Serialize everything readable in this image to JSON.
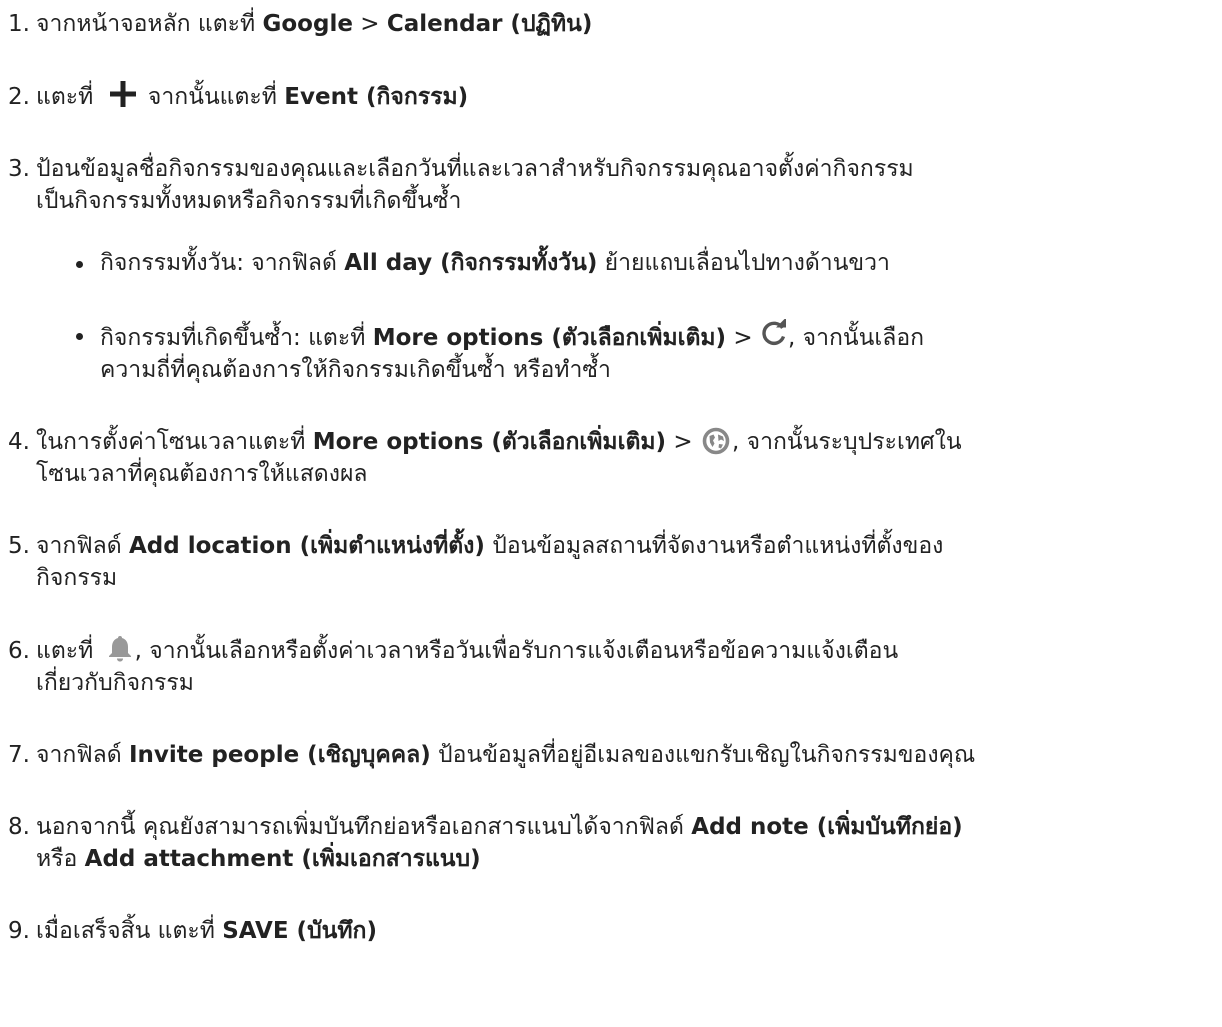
{
  "steps": [
    {
      "num": "1.",
      "prefix": "จากหน้าจอหลัก แตะที่ ",
      "bold1": "Google",
      "sep": " > ",
      "bold2": "Calendar (ปฏิทิน)"
    },
    {
      "num": "2.",
      "prefix": "แตะที่ ",
      "icon": "plus-icon",
      "middle": " จากนั้นแตะที่ ",
      "bold": "Event (กิจกรรม)"
    },
    {
      "num": "3.",
      "line1": "ป้อนข้อมูลชื่อกิจกรรมของคุณและเลือกวันที่และเวลาสำหรับกิจกรรมคุณอาจตั้งค่ากิจกรรม",
      "line2": "เป็นกิจกรรมทั้งหมดหรือกิจกรรมที่เกิดขึ้นซ้ำ",
      "bullets": [
        {
          "prefix": "กิจกรรมทั้งวัน: จากฟิลด์ ",
          "bold": "All day (กิจกรรมทั้งวัน)",
          "suffix": " ย้ายแถบเลื่อนไปทางด้านขวา"
        },
        {
          "prefix": "กิจกรรมที่เกิดขึ้นซ้ำ: แตะที่ ",
          "bold": "More options (ตัวเลือกเพิ่มเติม)",
          "sep": " > ",
          "icon": "repeat-icon",
          "suffix": ", จากนั้นเลือก",
          "line2": "ความถี่ที่คุณต้องการให้กิจกรรมเกิดขึ้นซ้ำ หรือทำซ้ำ"
        }
      ]
    },
    {
      "num": "4.",
      "prefix": "ในการตั้งค่าโซนเวลาแตะที่ ",
      "bold": "More options (ตัวเลือกเพิ่มเติม)",
      "sep": " > ",
      "icon": "globe-icon",
      "suffix": ", จากนั้นระบุประเทศใน",
      "line2": "โซนเวลาที่คุณต้องการให้แสดงผล"
    },
    {
      "num": "5.",
      "prefix": "จากฟิลด์ ",
      "bold": "Add location (เพิ่มตำแหน่งที่ตั้ง)",
      "suffix": " ป้อนข้อมูลสถานที่จัดงานหรือตำแหน่งที่ตั้งของ",
      "line2": "กิจกรรม"
    },
    {
      "num": "6.",
      "prefix": "แตะที่ ",
      "icon": "bell-icon",
      "suffix": ", จากนั้นเลือกหรือตั้งค่าเวลาหรือวันเพื่อรับการแจ้งเตือนหรือข้อความแจ้งเตือน",
      "line2": "เกี่ยวกับกิจกรรม"
    },
    {
      "num": "7.",
      "prefix": "จากฟิลด์ ",
      "bold": "Invite people (เชิญบุคคล)",
      "suffix": " ป้อนข้อมูลที่อยู่อีเมลของแขกรับเชิญในกิจกรรมของคุณ"
    },
    {
      "num": "8.",
      "prefix": "นอกจากนี้ คุณยังสามารถเพิ่มบันทึกย่อหรือเอกสารแนบได้จากฟิลด์ ",
      "bold1": "Add note (เพิ่มบันทึกย่อ)",
      "line2_prefix": "หรือ ",
      "bold2": "Add attachment (เพิ่มเอกสารแนบ)"
    },
    {
      "num": "9.",
      "prefix": "เมื่อเสร็จสิ้น แตะที่ ",
      "bold": "SAVE (บันทึก)"
    }
  ],
  "colors": {
    "text": "#222222",
    "icon": "#555555",
    "globe_icon": "#888888",
    "bell_icon": "#999999"
  }
}
